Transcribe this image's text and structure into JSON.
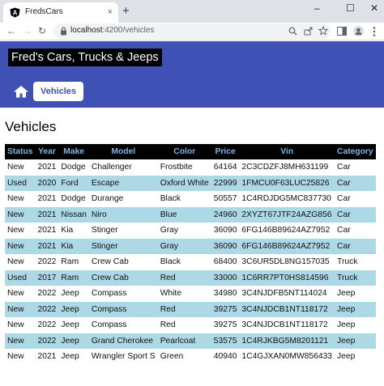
{
  "browser": {
    "tab_title": "FredsCars",
    "tab_close": "×",
    "new_tab": "+",
    "window_controls": {
      "minimize": "–",
      "maximize": "☐",
      "close": "✕"
    },
    "nav": {
      "back": "←",
      "forward": "→",
      "reload": "↻"
    },
    "url_host": "localhost",
    "url_path": ":4200/vehicles"
  },
  "app": {
    "brand": "Fred's Cars, Trucks & Jeeps",
    "nav_vehicles": "Vehicles"
  },
  "page": {
    "title": "Vehicles",
    "columns": [
      "Status",
      "Year",
      "Make",
      "Model",
      "Color",
      "Price",
      "Vin",
      "Category"
    ],
    "rows": [
      [
        "New",
        "2021",
        "Dodge",
        "Challenger",
        "Frostbite",
        "64164",
        "2C3CDZFJ8MH631199",
        "Car"
      ],
      [
        "Used",
        "2020",
        "Ford",
        "Escape",
        "Oxford White",
        "22999",
        "1FMCU0F63LUC25826",
        "Car"
      ],
      [
        "New",
        "2021",
        "Dodge",
        "Durange",
        "Black",
        "50557",
        "1C4RDJDG5MC837730",
        "Car"
      ],
      [
        "New",
        "2021",
        "Nissan",
        "Niro",
        "Blue",
        "24960",
        "2XYZT67JTF24AZG856",
        "Car"
      ],
      [
        "New",
        "2021",
        "Kia",
        "Stinger",
        "Gray",
        "36090",
        "6FG146B89624AZ7952",
        "Car"
      ],
      [
        "New",
        "2021",
        "Kia",
        "Stinger",
        "Gray",
        "36090",
        "6FG146B89624AZ7952",
        "Car"
      ],
      [
        "New",
        "2022",
        "Ram",
        "Crew Cab",
        "Black",
        "68400",
        "3C6UR5DL8NG157035",
        "Truck"
      ],
      [
        "Used",
        "2017",
        "Ram",
        "Crew Cab",
        "Red",
        "33000",
        "1C6RR7PT0HS814596",
        "Truck"
      ],
      [
        "New",
        "2022",
        "Jeep",
        "Compass",
        "White",
        "34980",
        "3C4NJDFB5NT114024",
        "Jeep"
      ],
      [
        "New",
        "2022",
        "Jeep",
        "Compass",
        "Red",
        "39275",
        "3C4NJDCB1NT118172",
        "Jeep"
      ],
      [
        "New",
        "2022",
        "Jeep",
        "Compass",
        "Red",
        "39275",
        "3C4NJDCB1NT118172",
        "Jeep"
      ],
      [
        "New",
        "2022",
        "Jeep",
        "Grand Cherokee",
        "Pearlcoat",
        "53575",
        "1C4RJKBG5M8201121",
        "Jeep"
      ],
      [
        "New",
        "2021",
        "Jeep",
        "Wrangler Sport S",
        "Green",
        "40940",
        "1C4GJXAN0MW856433",
        "Jeep"
      ]
    ]
  },
  "colors": {
    "header": "#3f51b5",
    "row_alt": "#add8e6",
    "table_header_bg": "#000000",
    "table_header_text": "#7fb3e6"
  },
  "icons": [
    "angular-favicon",
    "home-icon",
    "lock-icon",
    "zoom-icon",
    "share-icon",
    "star-icon",
    "sidepanel-icon",
    "profile-icon",
    "menu-icon"
  ]
}
